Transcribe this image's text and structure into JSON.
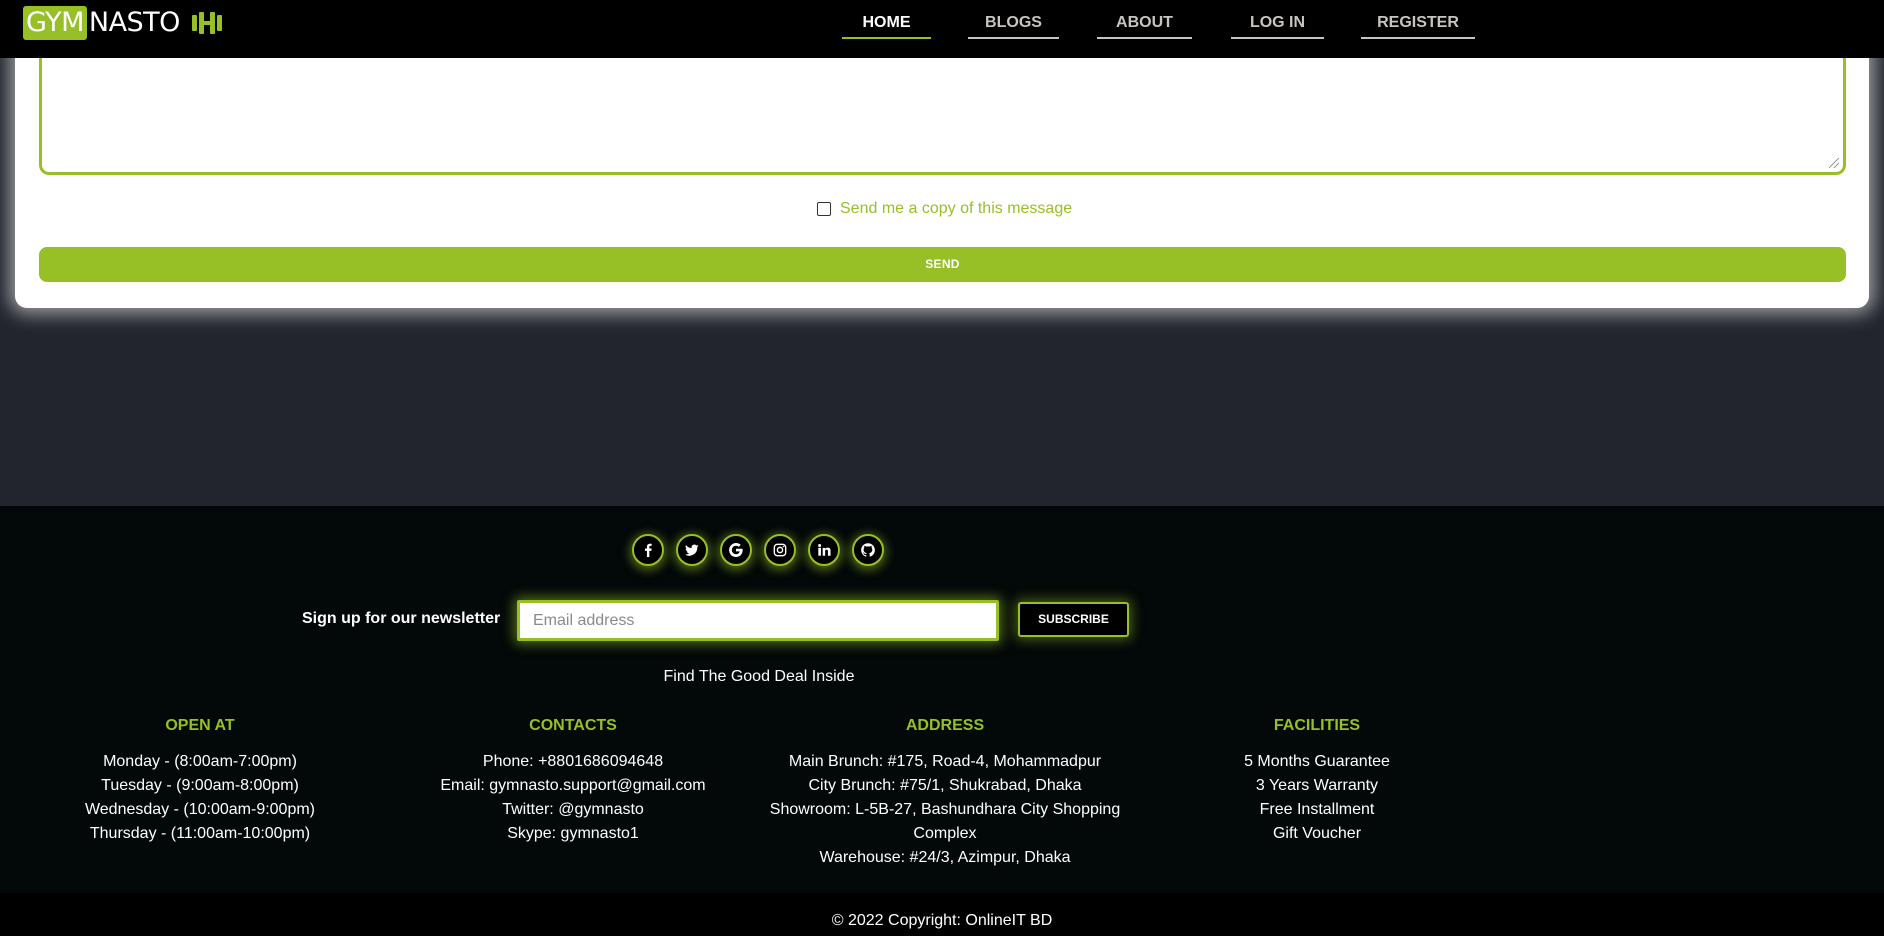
{
  "brand": {
    "part1": "GYM",
    "part2": "NASTO",
    "icon": "dumbbell-icon"
  },
  "nav": {
    "items": [
      {
        "label": "HOME",
        "active": true
      },
      {
        "label": "BLOGS",
        "active": false
      },
      {
        "label": "ABOUT",
        "active": false
      },
      {
        "label": "LOG IN",
        "active": false
      },
      {
        "label": "REGISTER",
        "active": false
      }
    ]
  },
  "contact_form": {
    "message_value": "",
    "copy_label": "Send me a copy of this message",
    "copy_checked": false,
    "send_label": "SEND"
  },
  "footer": {
    "social_icons": [
      "facebook-icon",
      "twitter-icon",
      "google-icon",
      "instagram-icon",
      "linkedin-icon",
      "github-icon"
    ],
    "newsletter": {
      "label": "Sign up for our newsletter",
      "placeholder": "Email address",
      "button": "SUBSCRIBE"
    },
    "deal_text": "Find The Good Deal Inside",
    "columns": [
      {
        "title": "OPEN AT",
        "lines": [
          "Monday - (8:00am-7:00pm)",
          "Tuesday - (9:00am-8:00pm)",
          "Wednesday - (10:00am-9:00pm)",
          "Thursday - (11:00am-10:00pm)"
        ]
      },
      {
        "title": "CONTACTS",
        "lines": [
          "Phone: +8801686094648",
          "Email: gymnasto.support@gmail.com",
          "Twitter: @gymnasto",
          "Skype: gymnasto1"
        ]
      },
      {
        "title": "ADDRESS",
        "lines": [
          "Main Brunch: #175, Road-4, Mohammadpur",
          "City Brunch: #75/1, Shukrabad, Dhaka",
          "Showroom: L-5B-27, Bashundhara City Shopping Complex",
          "Warehouse: #24/3, Azimpur, Dhaka"
        ]
      },
      {
        "title": "FACILITIES",
        "lines": [
          "5 Months Guarantee",
          "3 Years Warranty",
          "Free Installment",
          "Gift Voucher"
        ]
      }
    ],
    "copyright": "© 2022 Copyright: OnlineIT BD"
  },
  "colors": {
    "accent": "#97bf26",
    "navbar": "#000000",
    "page_bg": "#22252e",
    "footer_bg": "#030808"
  }
}
